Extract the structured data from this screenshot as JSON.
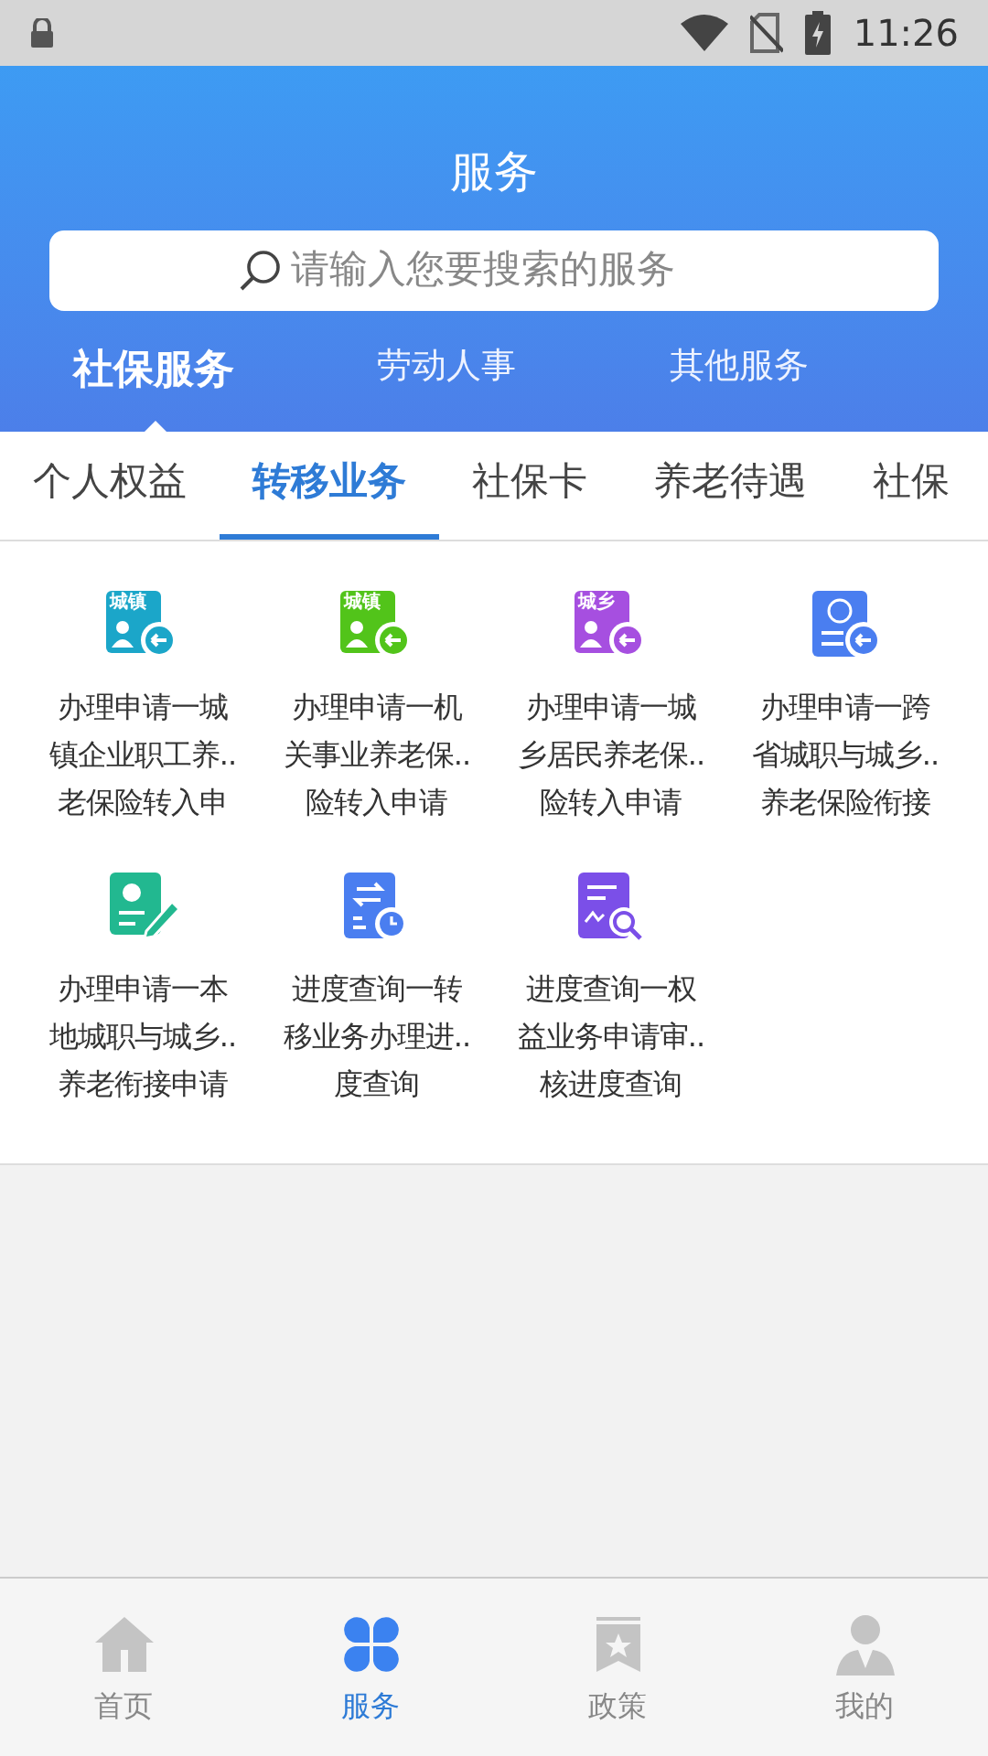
{
  "status_bar": {
    "time": "11:26"
  },
  "header": {
    "title": "服务",
    "search": {
      "placeholder": "请输入您要搜索的服务"
    }
  },
  "tabs": [
    {
      "label": "社保服务",
      "selected": true
    },
    {
      "label": "劳动人事",
      "selected": false
    },
    {
      "label": "其他服务",
      "selected": false
    }
  ],
  "sub_tabs": [
    {
      "label": "个人权益",
      "selected": false
    },
    {
      "label": "转移业务",
      "selected": true
    },
    {
      "label": "社保卡",
      "selected": false
    },
    {
      "label": "养老待遇",
      "selected": false
    },
    {
      "label": "社保",
      "selected": false
    }
  ],
  "services": [
    {
      "kind": "transfer",
      "color": "#1ba6c9",
      "badge": "城镇",
      "lines": [
        "办理申请一城",
        "镇企业职工养..",
        "老保险转入申"
      ]
    },
    {
      "kind": "transfer",
      "color": "#52c41a",
      "badge": "城镇",
      "lines": [
        "办理申请一机",
        "关事业养老保..",
        "险转入申请"
      ]
    },
    {
      "kind": "transfer",
      "color": "#a64fe0",
      "badge": "城乡",
      "lines": [
        "办理申请一城",
        "乡居民养老保..",
        "险转入申请"
      ]
    },
    {
      "kind": "network",
      "color": "#4a7ef0",
      "lines": [
        "办理申请一跨",
        "省城职与城乡..",
        "养老保险衔接"
      ]
    },
    {
      "kind": "pen",
      "color": "#22b890",
      "lines": [
        "办理申请一本",
        "地城职与城乡..",
        "养老衔接申请"
      ]
    },
    {
      "kind": "exchange",
      "color": "#4a7ef0",
      "lines": [
        "进度查询一转",
        "移业务办理进..",
        "度查询"
      ]
    },
    {
      "kind": "inspect",
      "color": "#7b4fe8",
      "lines": [
        "进度查询一权",
        "益业务申请审..",
        "核进度查询"
      ]
    }
  ],
  "bottom_nav": [
    {
      "label": "首页",
      "kind": "home",
      "selected": false
    },
    {
      "label": "服务",
      "kind": "services",
      "selected": true
    },
    {
      "label": "政策",
      "kind": "policy",
      "selected": false
    },
    {
      "label": "我的",
      "kind": "profile",
      "selected": false
    }
  ]
}
